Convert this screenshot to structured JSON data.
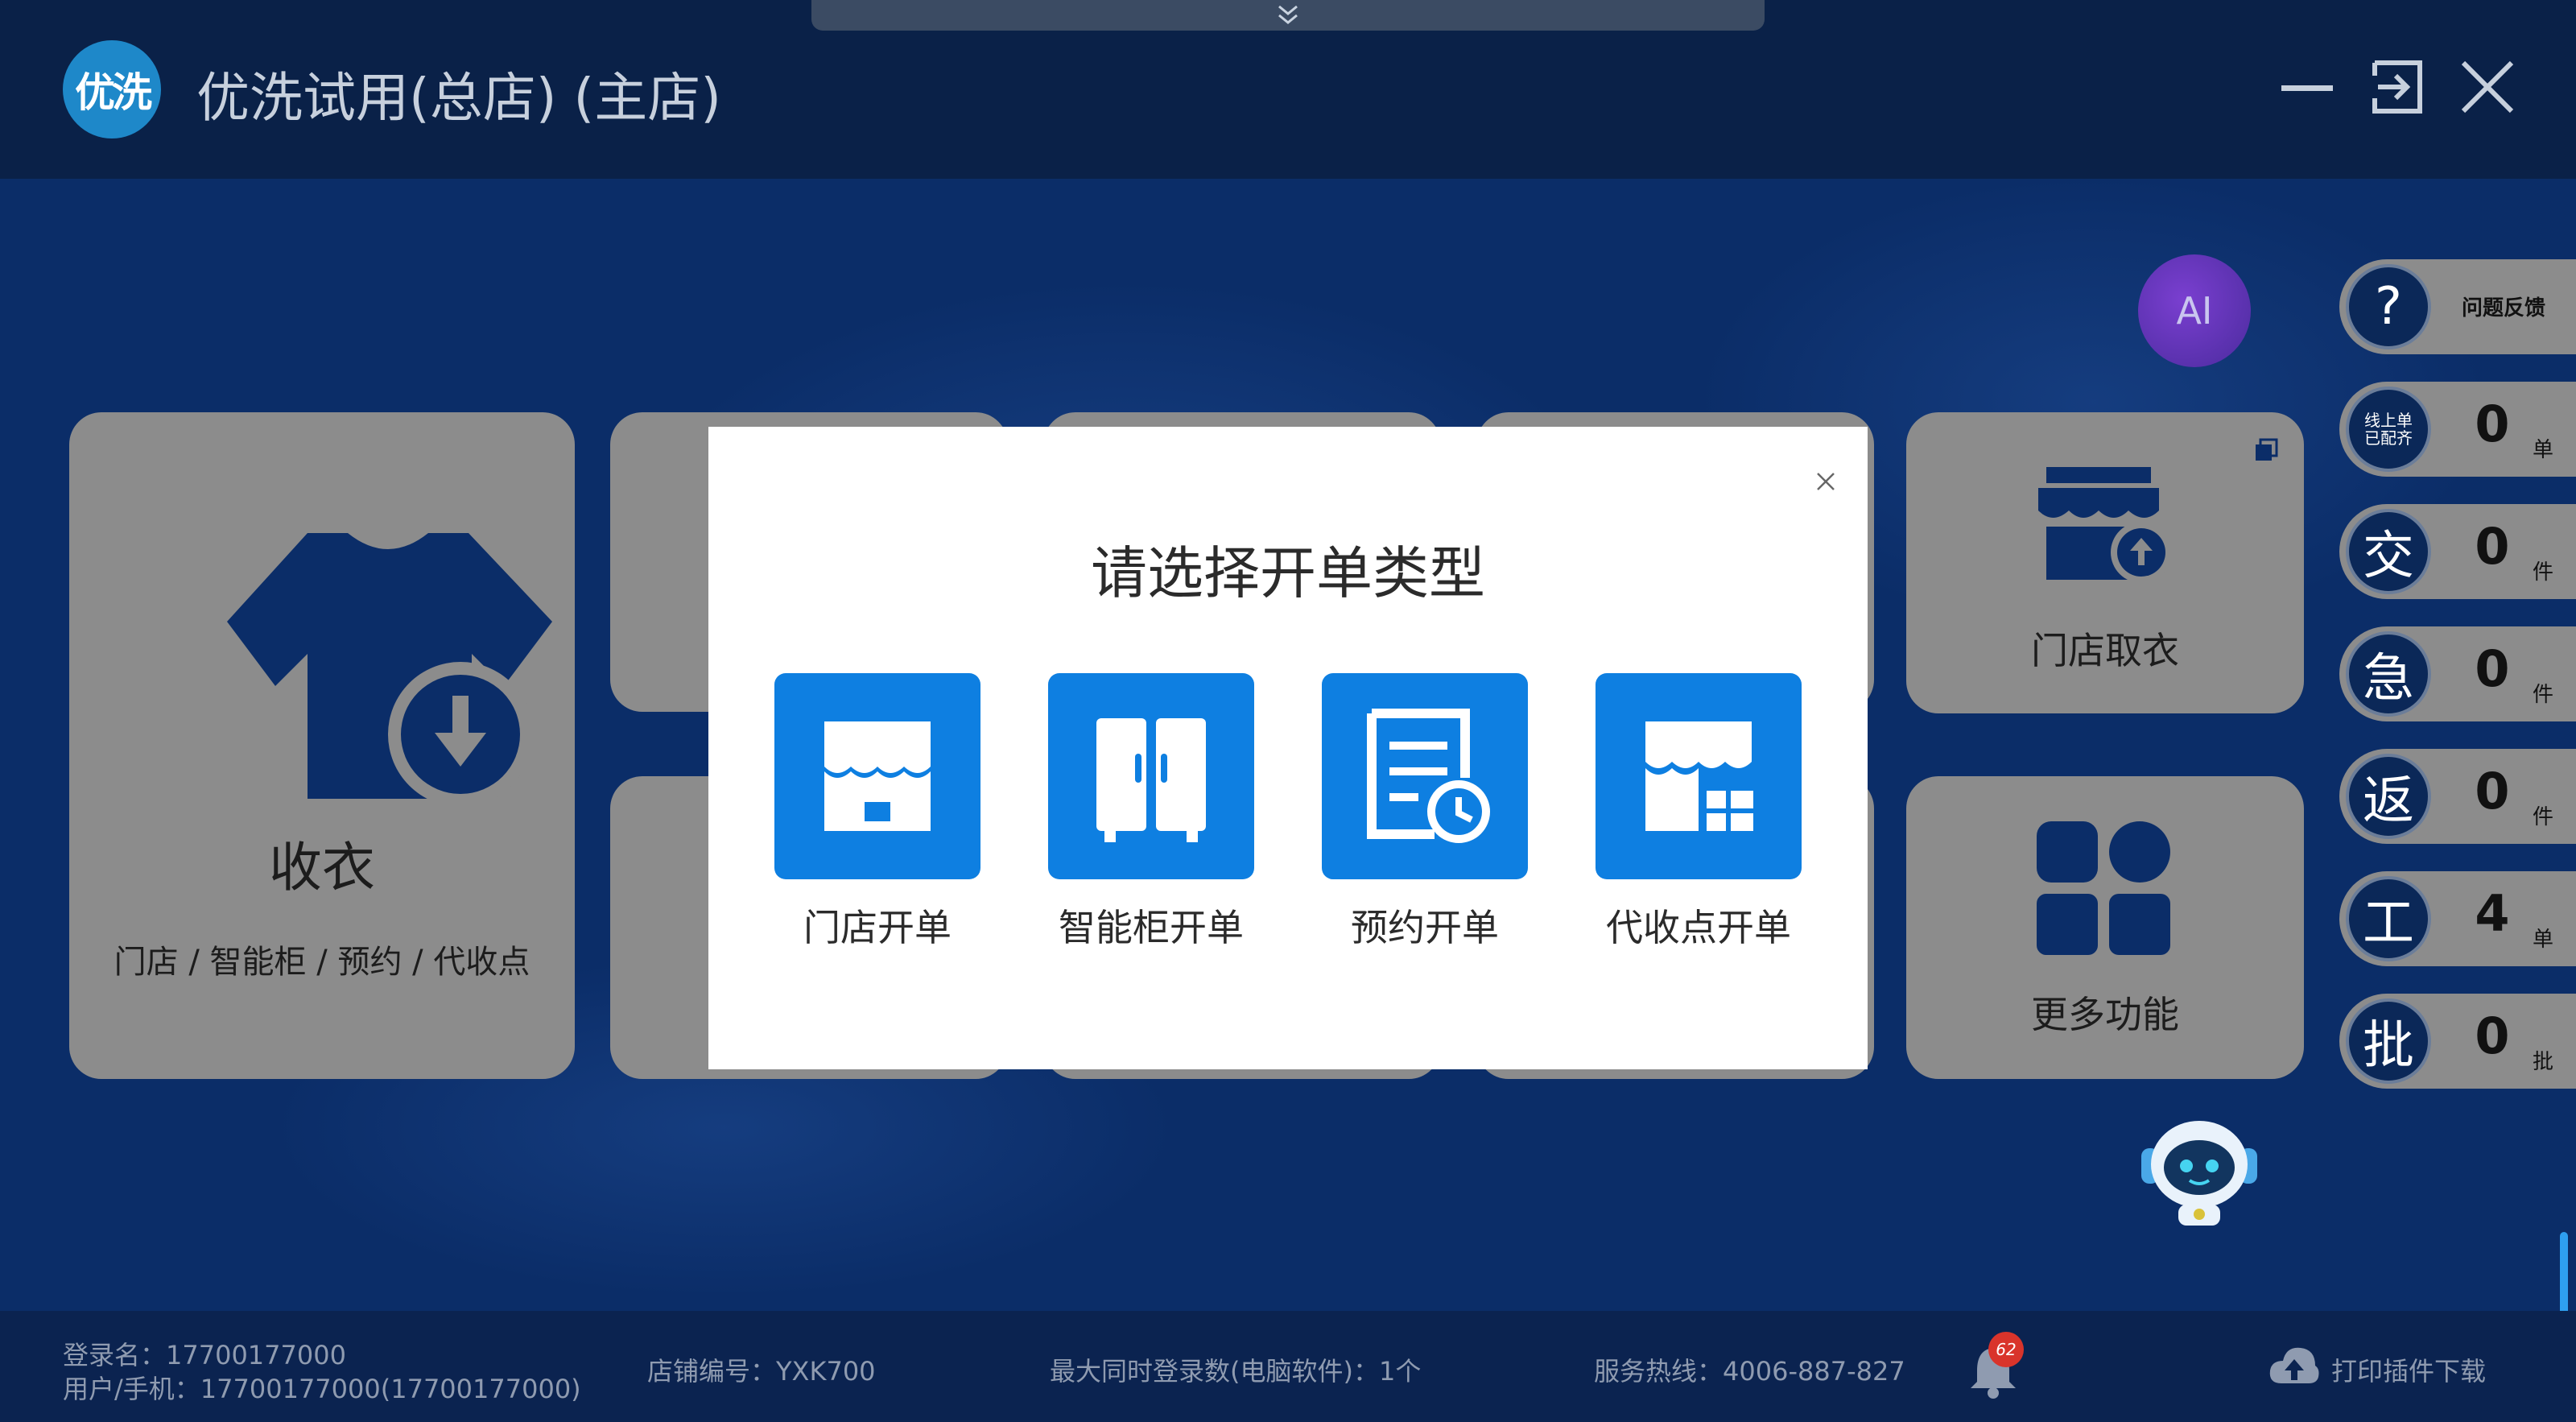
{
  "window": {
    "title": "优洗试用(总店) (主店)",
    "logo_text": "优洗",
    "collapse_icon": "double-chevron-down-icon"
  },
  "main_card": {
    "title": "收衣",
    "subtitle": "门店 / 智能柜 / 预约 / 代收点"
  },
  "right_cards": [
    {
      "label": "门店取衣"
    },
    {
      "label": "更多功能"
    }
  ],
  "ai_button": {
    "label": "AI"
  },
  "side_pills": {
    "feedback": {
      "icon_text": "?",
      "label": "问题反馈"
    },
    "online": {
      "icon_text_line1": "线上单",
      "icon_text_line2": "已配齐",
      "count": "0",
      "unit": "单"
    },
    "deliver": {
      "icon_text": "交",
      "count": "0",
      "unit": "件"
    },
    "urgent": {
      "icon_text": "急",
      "count": "0",
      "unit": "件"
    },
    "return": {
      "icon_text": "返",
      "count": "0",
      "unit": "件"
    },
    "work": {
      "icon_text": "工",
      "count": "4",
      "unit": "单"
    },
    "batch": {
      "icon_text": "批",
      "count": "0",
      "unit": "批"
    }
  },
  "modal": {
    "title": "请选择开单类型",
    "close_icon": "close-icon",
    "options": [
      {
        "label": "门店开单",
        "icon": "storefront-icon"
      },
      {
        "label": "智能柜开单",
        "icon": "locker-icon"
      },
      {
        "label": "预约开单",
        "icon": "appointment-icon"
      },
      {
        "label": "代收点开单",
        "icon": "agent-store-icon"
      }
    ]
  },
  "footer": {
    "login_name": "登录名：17700177000",
    "user_phone": "用户/手机：17700177000(17700177000)",
    "store_no": "店铺编号：YXK700",
    "max_login": "最大同时登录数(电脑软件)：1个",
    "hotline": "服务热线：4006-887-827",
    "notification_count": "62",
    "print_plugin": "打印插件下载"
  },
  "colors": {
    "header_bg": "#0a2148",
    "body_bg": "#0b2d68",
    "card_gray": "#8c8c8c",
    "accent_blue": "#0e7fe1",
    "footer_bg": "#0b2350",
    "badge_red": "#d9342b"
  }
}
